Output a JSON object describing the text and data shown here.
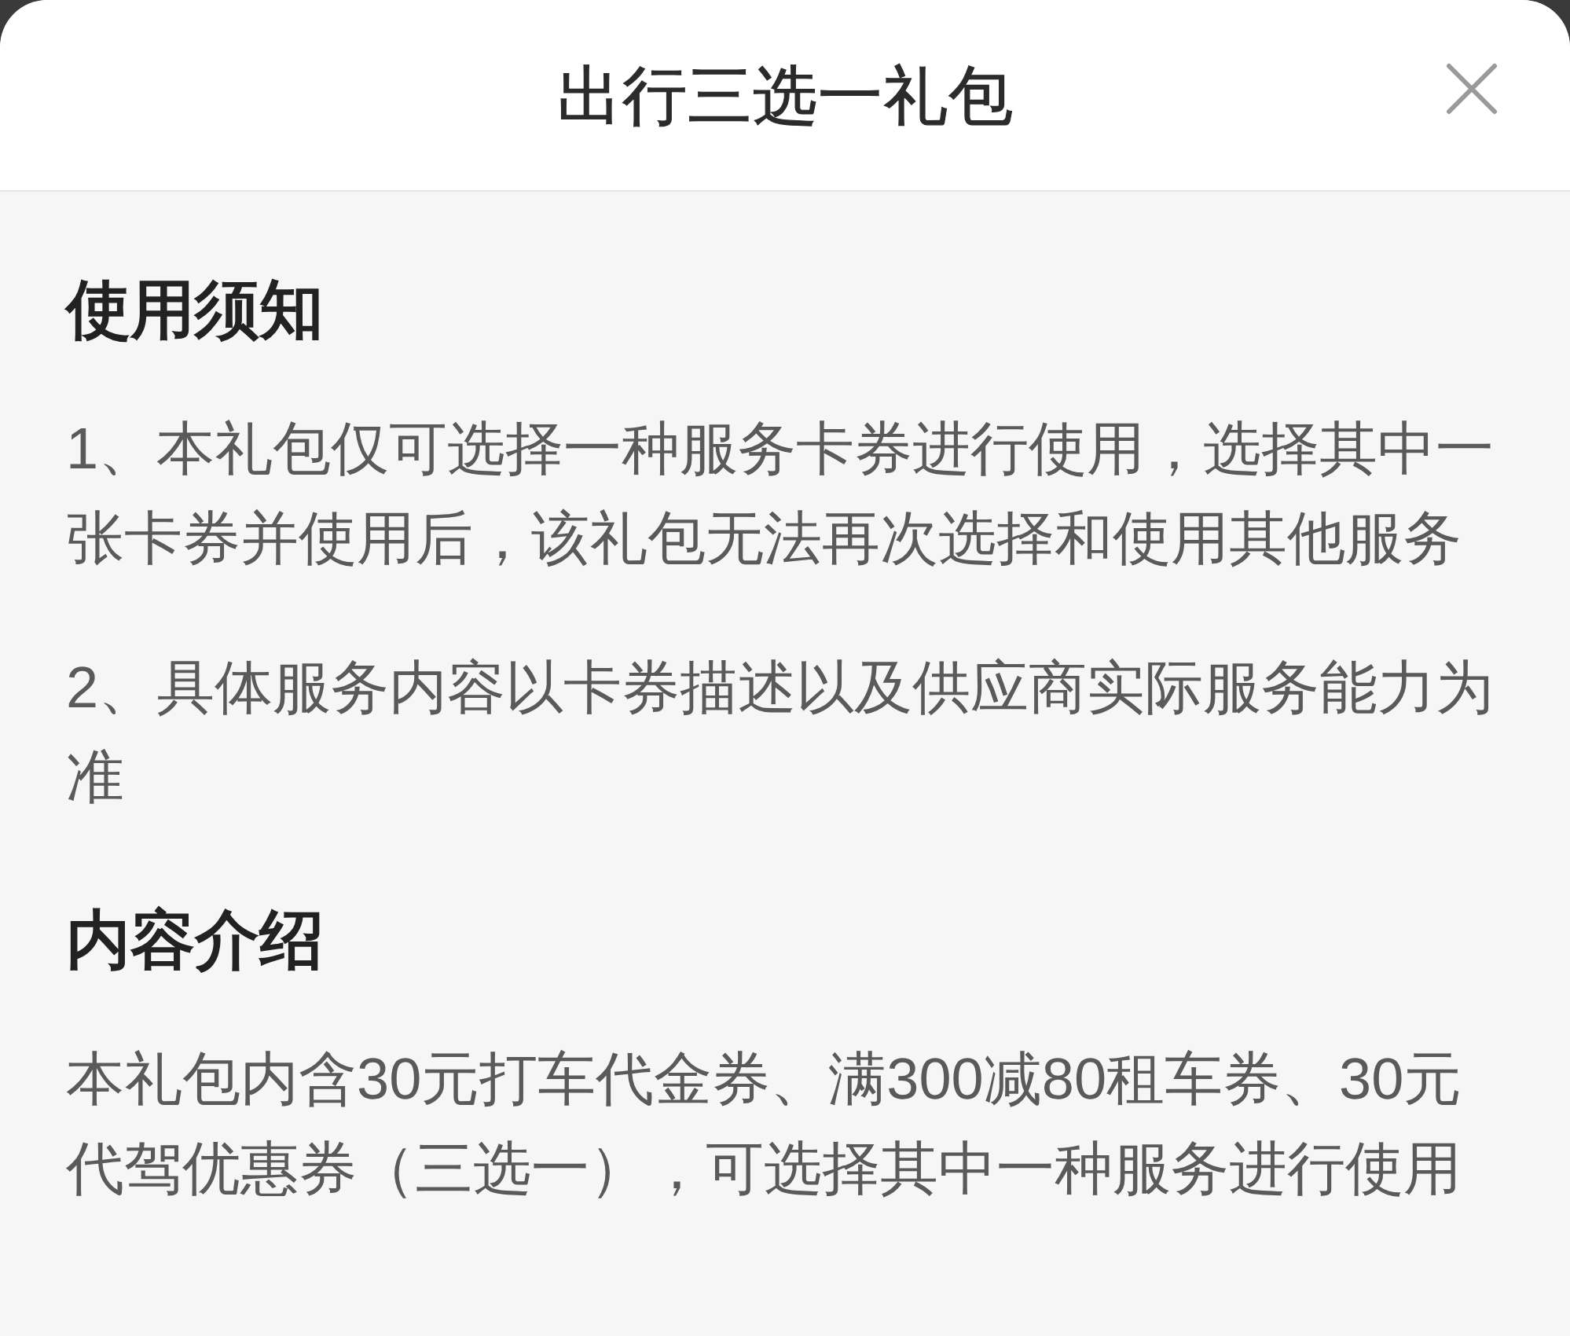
{
  "sheet": {
    "title": "出行三选一礼包"
  },
  "sections": [
    {
      "heading": "使用须知",
      "paragraphs": [
        "1、本礼包仅可选择一种服务卡券进行使用，选择其中一张卡券并使用后，该礼包无法再次选择和使用其他服务",
        "2、具体服务内容以卡券描述以及供应商实际服务能力为准"
      ]
    },
    {
      "heading": "内容介绍",
      "paragraphs": [
        "本礼包内含30元打车代金券、满300减80租车券、30元代驾优惠券（三选一），可选择其中一种服务进行使用"
      ]
    }
  ]
}
